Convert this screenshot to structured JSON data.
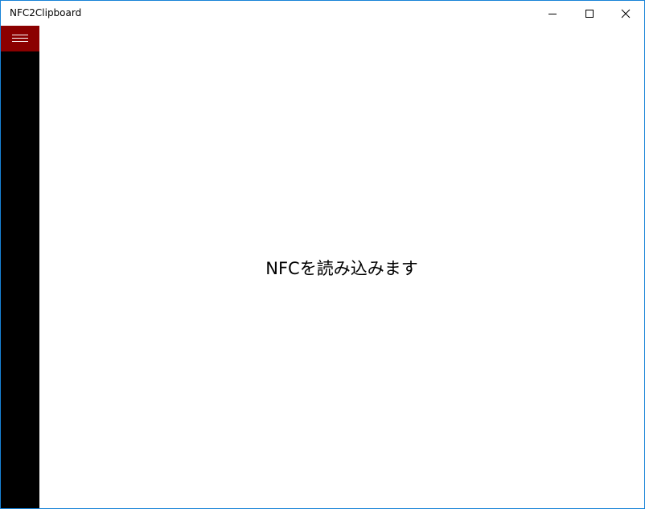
{
  "window": {
    "title": "NFC2Clipboard",
    "border_color": "#1883d7"
  },
  "caption_buttons": {
    "minimize_icon": "minimize-icon",
    "maximize_icon": "maximize-icon",
    "close_icon": "close-icon"
  },
  "sidebar": {
    "background": "#000000",
    "menu_button_color": "#8b0000",
    "menu_icon": "hamburger-icon"
  },
  "main": {
    "message": "NFCを読み込みます"
  }
}
